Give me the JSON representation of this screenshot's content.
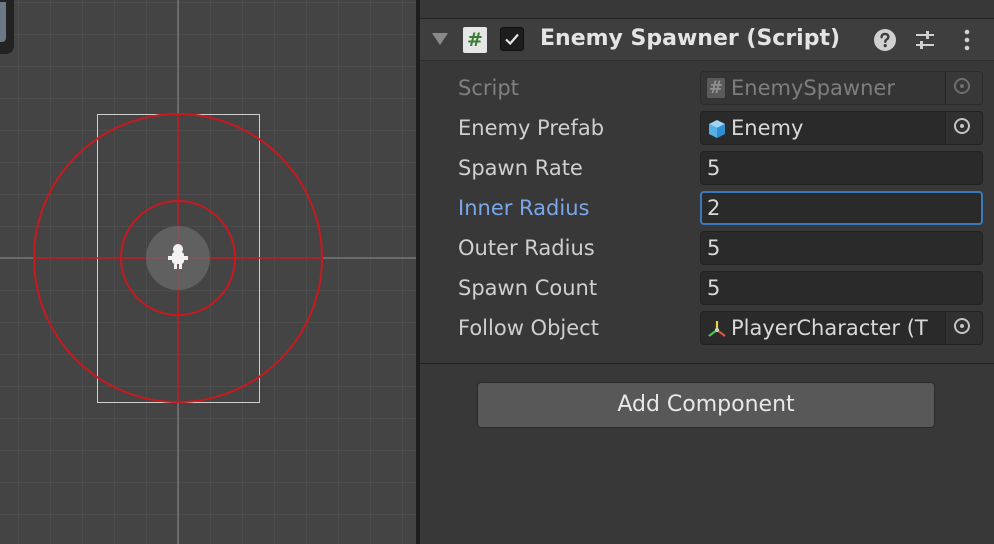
{
  "scene": {
    "gizmo_color": "#c8191e",
    "selection_box_color": "#cfcfcf"
  },
  "component": {
    "title": "Enemy Spawner (Script)",
    "script_icon_glyph": "#",
    "enabled": true,
    "icons": [
      "help-icon",
      "presets-icon",
      "more-menu-icon"
    ]
  },
  "fields": {
    "script": {
      "label": "Script",
      "value": "EnemySpawner",
      "icon": "#"
    },
    "enemy_prefab": {
      "label": "Enemy Prefab",
      "value": "Enemy",
      "icon": "prefab-cube-icon"
    },
    "spawn_rate": {
      "label": "Spawn Rate",
      "value": "5"
    },
    "inner_radius": {
      "label": "Inner Radius",
      "value": "2"
    },
    "outer_radius": {
      "label": "Outer Radius",
      "value": "5"
    },
    "spawn_count": {
      "label": "Spawn Count",
      "value": "5"
    },
    "follow_object": {
      "label": "Follow Object",
      "value": "PlayerCharacter (T",
      "icon": "transform-icon"
    }
  },
  "add_component_label": "Add Component",
  "colors": {
    "active_label": "#7aa7ea",
    "focus_border": "#3a79bb",
    "script_icon_green": "#3a7c33"
  }
}
